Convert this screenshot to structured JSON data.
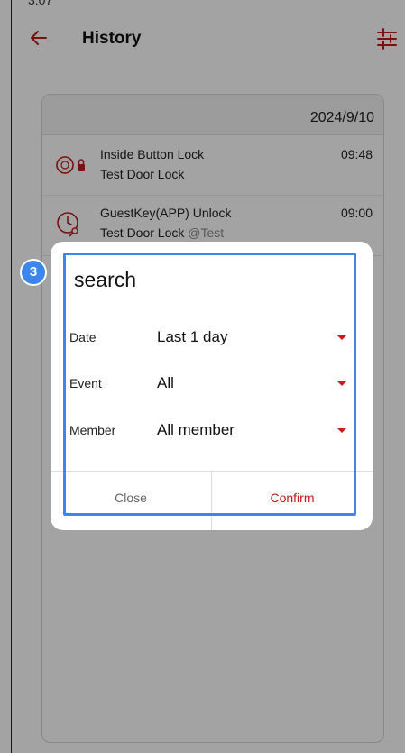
{
  "status_bar": {
    "time": "3:07"
  },
  "header": {
    "title": "History",
    "back_icon": "arrow-left-icon",
    "filter_icon": "filter-sliders-icon"
  },
  "history": {
    "date": "2024/9/10",
    "events": [
      {
        "title": "Inside Button Lock",
        "device": "Test Door Lock",
        "member": "",
        "time": "09:48",
        "icon": "inside-button-lock-icon"
      },
      {
        "title": "GuestKey(APP) Unlock",
        "device": "Test Door Lock",
        "member": "@Test",
        "time": "09:00",
        "icon": "guest-key-clock-icon"
      }
    ]
  },
  "dialog": {
    "title": "search",
    "fields": [
      {
        "label": "Date",
        "value": "Last 1 day"
      },
      {
        "label": "Event",
        "value": "All"
      },
      {
        "label": "Member",
        "value": "All member"
      }
    ],
    "close_label": "Close",
    "confirm_label": "Confirm"
  },
  "annotation": {
    "step": "3"
  },
  "colors": {
    "accent": "#c01a1a",
    "highlight": "#3d86ea",
    "overlay": "rgba(0,0,0,0.36)"
  }
}
